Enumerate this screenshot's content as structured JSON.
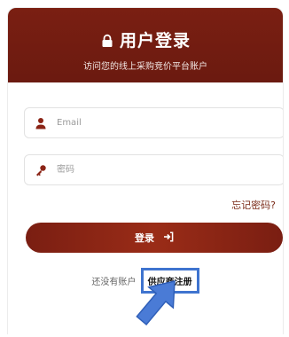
{
  "header": {
    "title": "用户登录",
    "subtitle": "访问您的线上采购竞价平台账户"
  },
  "form": {
    "email_placeholder": "Email",
    "password_placeholder": "密码"
  },
  "forgot_password": "忘记密码?",
  "login_button": "登录",
  "register": {
    "prompt": "还没有账户",
    "link": "供应商注册"
  },
  "colors": {
    "accent": "#7a1f12",
    "highlight": "#3f74cf"
  }
}
